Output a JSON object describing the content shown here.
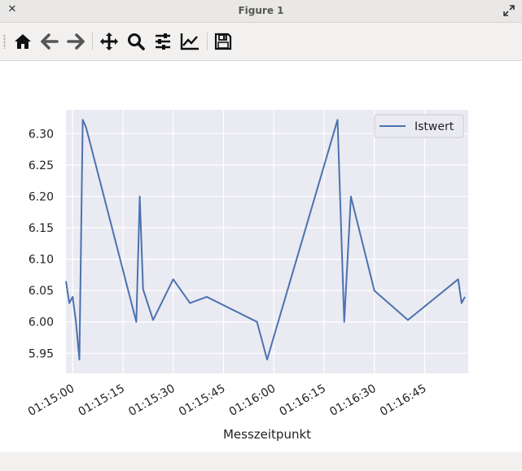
{
  "window": {
    "title": "Figure 1"
  },
  "toolbar": {
    "buttons": [
      {
        "name": "home-button",
        "icon": "home-icon"
      },
      {
        "name": "back-button",
        "icon": "arrow-left-icon"
      },
      {
        "name": "forward-button",
        "icon": "arrow-right-icon"
      },
      {
        "name": "pan-button",
        "icon": "move-icon"
      },
      {
        "name": "zoom-button",
        "icon": "magnifier-icon"
      },
      {
        "name": "configure-subplots-button",
        "icon": "sliders-icon"
      },
      {
        "name": "edit-axis-button",
        "icon": "line-chart-icon"
      },
      {
        "name": "save-button",
        "icon": "floppy-icon"
      }
    ]
  },
  "chart_data": {
    "type": "line",
    "title": "",
    "xlabel": "Messzeitpunkt",
    "ylabel": "",
    "x_unit": "seconds since 01:15:00",
    "x_range": [
      "01:14:58",
      "01:16:58"
    ],
    "ylim": [
      5.918,
      6.338
    ],
    "x_ticks": [
      "01:15:00",
      "01:15:15",
      "01:15:30",
      "01:15:45",
      "01:16:00",
      "01:16:15",
      "01:16:30",
      "01:16:45"
    ],
    "y_ticks": [
      "5.95",
      "6.00",
      "6.05",
      "6.10",
      "6.15",
      "6.20",
      "6.25",
      "6.30"
    ],
    "grid": true,
    "legend": {
      "position": "top-right"
    },
    "series": [
      {
        "name": "Istwert",
        "color": "#4c72b0",
        "times": [
          "01:14:58",
          "01:14:59",
          "01:15:00",
          "01:15:01",
          "01:15:02",
          "01:15:03",
          "01:15:04",
          "01:15:19",
          "01:15:20",
          "01:15:21",
          "01:15:24",
          "01:15:30",
          "01:15:35",
          "01:15:40",
          "01:15:55",
          "01:15:58",
          "01:16:19",
          "01:16:21",
          "01:16:23",
          "01:16:30",
          "01:16:40",
          "01:16:55",
          "01:16:56",
          "01:16:57"
        ],
        "values": [
          6.065,
          6.03,
          6.04,
          6.0,
          5.94,
          6.322,
          6.31,
          6.0,
          6.2,
          6.052,
          6.003,
          6.068,
          6.03,
          6.04,
          6.0,
          5.94,
          6.322,
          6.0,
          6.2,
          6.05,
          6.003,
          6.068,
          6.03,
          6.04
        ]
      }
    ]
  }
}
